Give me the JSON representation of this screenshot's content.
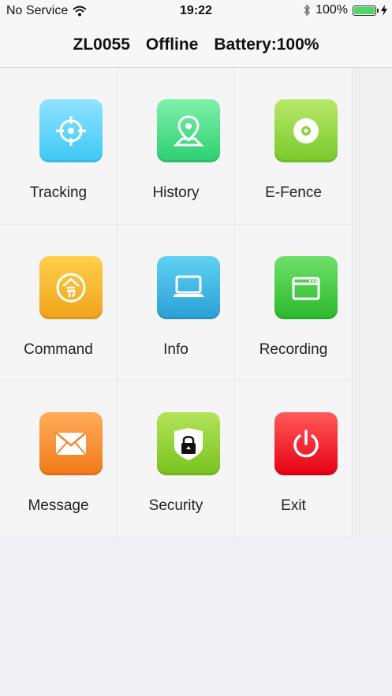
{
  "status": {
    "carrier": "No Service",
    "time": "19:22",
    "battery_percent": "100%",
    "battery_level": 1.0
  },
  "header": {
    "device_id": "ZL0055",
    "connection": "Offline",
    "battery": "Battery:100%"
  },
  "menu": [
    {
      "label": "Tracking",
      "icon": "crosshair-icon",
      "color_top": "#8fe3ff",
      "color_bottom": "#3cc8f5"
    },
    {
      "label": "History",
      "icon": "map-pin-icon",
      "color_top": "#7ff0a8",
      "color_bottom": "#2ccf74"
    },
    {
      "label": "E-Fence",
      "icon": "target-disc-icon",
      "color_top": "#b8e86a",
      "color_bottom": "#78c92a"
    },
    {
      "label": "Command",
      "icon": "command-badge-icon",
      "color_top": "#ffd04d",
      "color_bottom": "#f0a21a"
    },
    {
      "label": "Info",
      "icon": "laptop-icon",
      "color_top": "#5fd2f2",
      "color_bottom": "#2a9fd6"
    },
    {
      "label": "Recording",
      "icon": "recorder-icon",
      "color_top": "#6ee06a",
      "color_bottom": "#2bb82c"
    },
    {
      "label": "Message",
      "icon": "envelope-icon",
      "color_top": "#ffac5a",
      "color_bottom": "#f07a18"
    },
    {
      "label": "Security",
      "icon": "shield-lock-icon",
      "color_top": "#b4e35a",
      "color_bottom": "#78c21e"
    },
    {
      "label": "Exit",
      "icon": "power-icon",
      "color_top": "#ff5a5a",
      "color_bottom": "#e60012"
    }
  ]
}
